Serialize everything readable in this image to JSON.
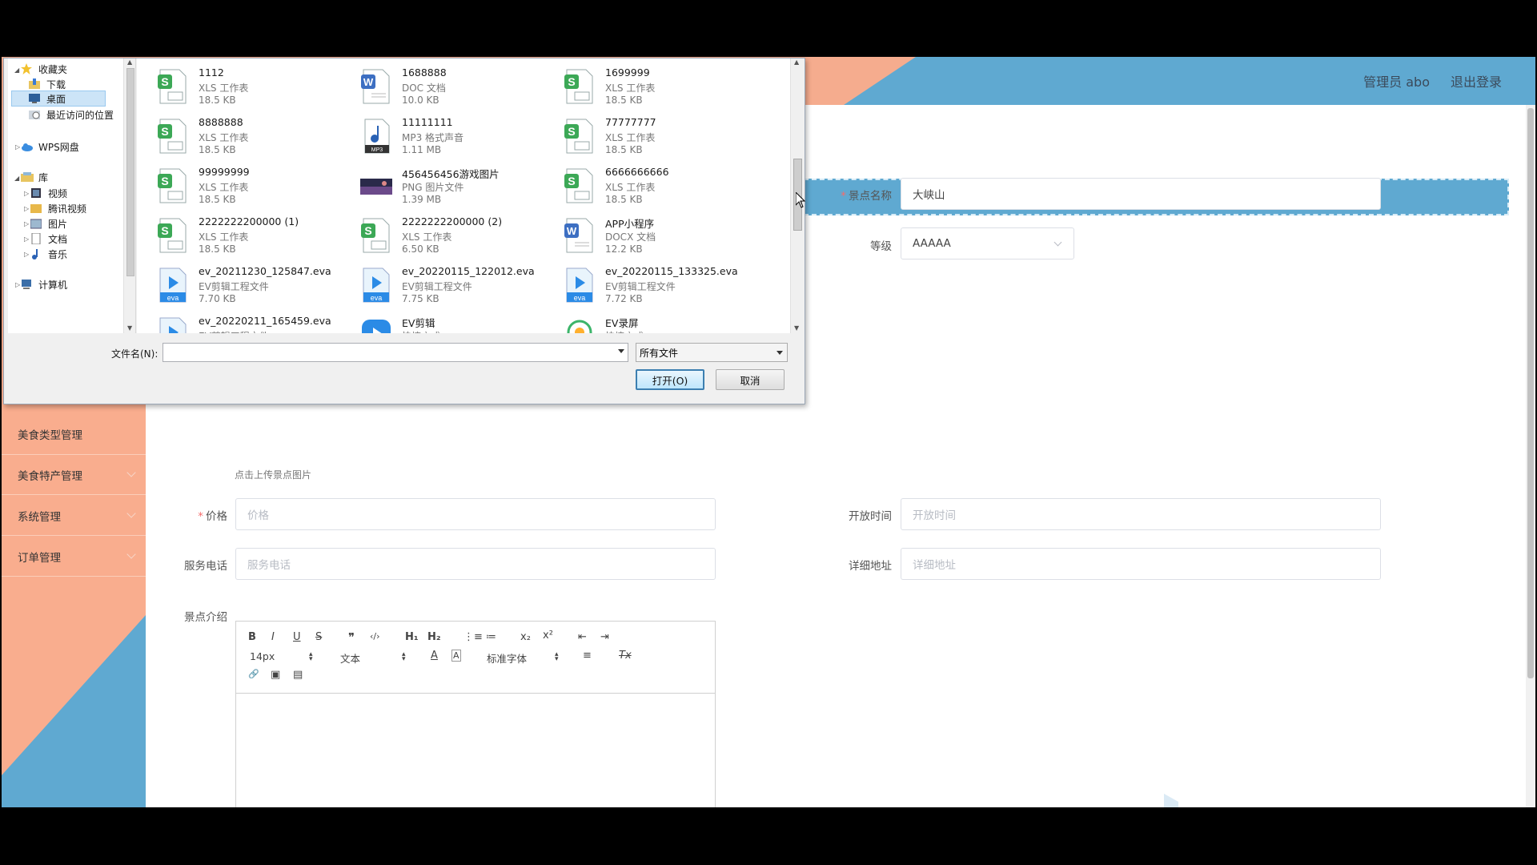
{
  "header": {
    "admin_label": "管理员 abo",
    "logout_label": "退出登录"
  },
  "sidebar": {
    "items": [
      {
        "label": "美食类型管理"
      },
      {
        "label": "美食特产管理"
      },
      {
        "label": "系统管理"
      },
      {
        "label": "订单管理"
      }
    ]
  },
  "form": {
    "name_label": "景点名称",
    "name_value": "大峡山",
    "level_label": "等级",
    "level_value": "AAAAA",
    "upload_hint": "点击上传景点图片",
    "price_label": "价格",
    "price_placeholder": "价格",
    "open_time_label": "开放时间",
    "open_time_placeholder": "开放时间",
    "phone_label": "服务电话",
    "phone_placeholder": "服务电话",
    "address_label": "详细地址",
    "address_placeholder": "详细地址",
    "intro_label": "景点介绍",
    "required_mark": "*"
  },
  "editor": {
    "font_size": "14px",
    "block_format": "文本",
    "font_family": "标准字体",
    "buttons": {
      "bold": "B",
      "italic": "I",
      "underline": "U",
      "strike": "S",
      "quote": "❞",
      "code": "‹/›",
      "h1": "H₁",
      "h2": "H₂",
      "ol": "⋮≡",
      "ul": "≔",
      "sub": "x₂",
      "sup": "x²",
      "outdent": "⇤",
      "indent": "⇥",
      "color": "A",
      "bg": "A",
      "align": "≡",
      "clear": "Tx",
      "link": "🔗",
      "image": "▣",
      "video": "▤"
    }
  },
  "dialog": {
    "tree": [
      {
        "label": "收藏夹",
        "icon": "star-icon"
      },
      {
        "label": "下载",
        "icon": "download-folder-icon"
      },
      {
        "label": "桌面",
        "icon": "desktop-icon"
      },
      {
        "label": "最近访问的位置",
        "icon": "recent-places-icon"
      },
      {
        "label": "WPS网盘",
        "icon": "cloud-icon"
      },
      {
        "label": "库",
        "icon": "library-icon"
      },
      {
        "label": "视频",
        "icon": "video-icon"
      },
      {
        "label": "腾讯视频",
        "icon": "folder-icon"
      },
      {
        "label": "图片",
        "icon": "pictures-icon"
      },
      {
        "label": "文档",
        "icon": "documents-icon"
      },
      {
        "label": "音乐",
        "icon": "music-icon"
      },
      {
        "label": "计算机",
        "icon": "computer-icon"
      }
    ],
    "files": [
      {
        "name": "1112",
        "type": "XLS 工作表",
        "size": "18.5 KB",
        "icon": "xls"
      },
      {
        "name": "1688888",
        "type": "DOC 文档",
        "size": "10.0 KB",
        "icon": "doc"
      },
      {
        "name": "1699999",
        "type": "XLS 工作表",
        "size": "18.5 KB",
        "icon": "xls"
      },
      {
        "name": "8888888",
        "type": "XLS 工作表",
        "size": "18.5 KB",
        "icon": "xls"
      },
      {
        "name": "11111111",
        "type": "MP3 格式声音",
        "size": "1.11 MB",
        "icon": "mp3"
      },
      {
        "name": "77777777",
        "type": "XLS 工作表",
        "size": "18.5 KB",
        "icon": "xls"
      },
      {
        "name": "99999999",
        "type": "XLS 工作表",
        "size": "18.5 KB",
        "icon": "xls"
      },
      {
        "name": "456456456游戏图片",
        "type": "PNG 图片文件",
        "size": "1.39 MB",
        "icon": "png"
      },
      {
        "name": "6666666666",
        "type": "XLS 工作表",
        "size": "18.5 KB",
        "icon": "xls"
      },
      {
        "name": "2222222200000 (1)",
        "type": "XLS 工作表",
        "size": "18.5 KB",
        "icon": "xls"
      },
      {
        "name": "2222222200000 (2)",
        "type": "XLS 工作表",
        "size": "6.50 KB",
        "icon": "xls"
      },
      {
        "name": "APP小程序",
        "type": "DOCX 文档",
        "size": "12.2 KB",
        "icon": "doc"
      },
      {
        "name": "ev_20211230_125847.eva",
        "type": "EV剪辑工程文件",
        "size": "7.70 KB",
        "icon": "eva"
      },
      {
        "name": "ev_20220115_122012.eva",
        "type": "EV剪辑工程文件",
        "size": "7.75 KB",
        "icon": "eva"
      },
      {
        "name": "ev_20220115_133325.eva",
        "type": "EV剪辑工程文件",
        "size": "7.72 KB",
        "icon": "eva"
      },
      {
        "name": "ev_20220211_165459.eva",
        "type": "EV剪辑工程文件",
        "size": "",
        "icon": "eva"
      },
      {
        "name": "EV剪辑",
        "type": "快捷方式",
        "size": "",
        "icon": "evapp"
      },
      {
        "name": "EV录屏",
        "type": "快捷方式",
        "size": "",
        "icon": "evrec"
      }
    ],
    "filename_label": "文件名(N):",
    "filename_value": "",
    "filter_value": "所有文件",
    "open_label": "打开(O)",
    "cancel_label": "取消"
  },
  "colors": {
    "header_blue": "#5fa9d1",
    "salmon": "#f5ac8e",
    "required": "#f56c6c"
  }
}
